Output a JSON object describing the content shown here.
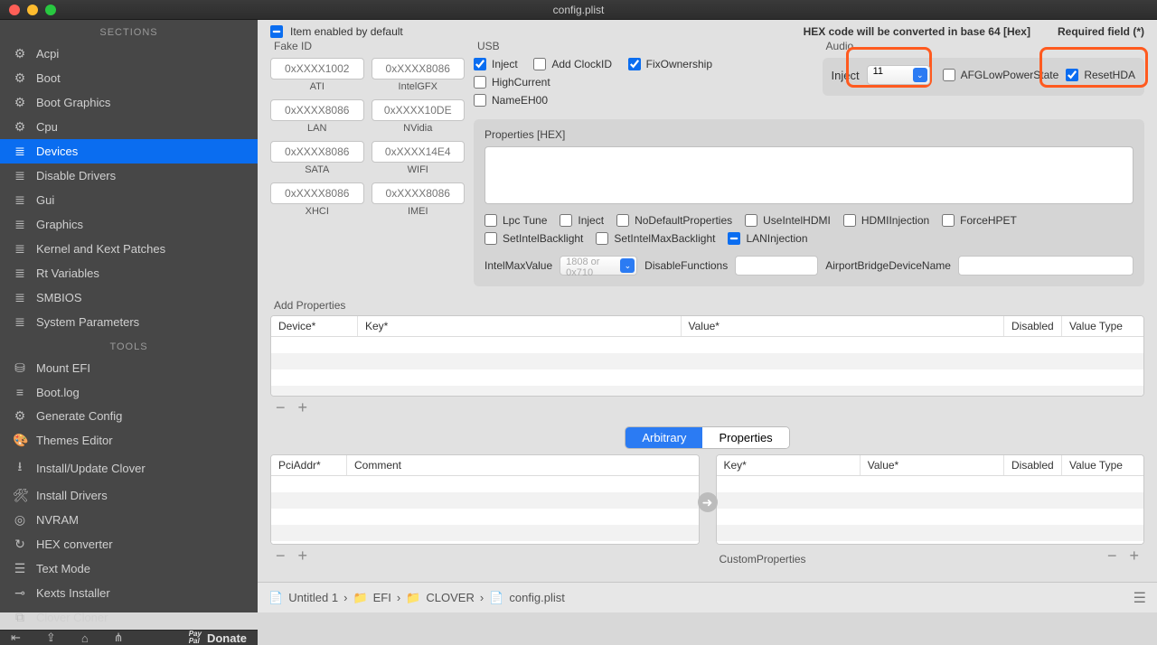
{
  "window": {
    "title": "config.plist"
  },
  "top": {
    "item_enabled": "Item enabled by default",
    "hex_hint": "HEX code will be converted in base 64 [Hex]",
    "required": "Required field (*)"
  },
  "sidebar": {
    "header_sections": "SECTIONS",
    "header_tools": "TOOLS",
    "sections": [
      {
        "label": "Acpi",
        "icon": "gear"
      },
      {
        "label": "Boot",
        "icon": "gear"
      },
      {
        "label": "Boot Graphics",
        "icon": "gear"
      },
      {
        "label": "Cpu",
        "icon": "gear"
      },
      {
        "label": "Devices",
        "icon": "list",
        "active": true
      },
      {
        "label": "Disable Drivers",
        "icon": "list"
      },
      {
        "label": "Gui",
        "icon": "list"
      },
      {
        "label": "Graphics",
        "icon": "list"
      },
      {
        "label": "Kernel and Kext Patches",
        "icon": "list"
      },
      {
        "label": "Rt Variables",
        "icon": "list"
      },
      {
        "label": "SMBIOS",
        "icon": "list"
      },
      {
        "label": "System Parameters",
        "icon": "list"
      }
    ],
    "tools": [
      {
        "label": "Mount EFI",
        "icon": "drive"
      },
      {
        "label": "Boot.log",
        "icon": "bars"
      },
      {
        "label": "Generate Config",
        "icon": "gear"
      },
      {
        "label": "Themes Editor",
        "icon": "palette"
      },
      {
        "label": "Install/Update Clover",
        "icon": "download"
      },
      {
        "label": "Install Drivers",
        "icon": "wrench"
      },
      {
        "label": "NVRAM",
        "icon": "chip"
      },
      {
        "label": "HEX converter",
        "icon": "refresh"
      },
      {
        "label": "Text Mode",
        "icon": "text"
      },
      {
        "label": "Kexts Installer",
        "icon": "key"
      },
      {
        "label": "Clover Cloner",
        "icon": "copy"
      }
    ],
    "footer": {
      "donate": "Donate",
      "paypal": "Pay\nPal"
    }
  },
  "fakeid": {
    "title": "Fake ID",
    "fields": [
      {
        "ph": "0xXXXX1002",
        "label": "ATI"
      },
      {
        "ph": "0xXXXX8086",
        "label": "IntelGFX"
      },
      {
        "ph": "0xXXXX8086",
        "label": "LAN"
      },
      {
        "ph": "0xXXXX10DE",
        "label": "NVidia"
      },
      {
        "ph": "0xXXXX8086",
        "label": "SATA"
      },
      {
        "ph": "0xXXXX14E4",
        "label": "WIFI"
      },
      {
        "ph": "0xXXXX8086",
        "label": "XHCI"
      },
      {
        "ph": "0xXXXX8086",
        "label": "IMEI"
      }
    ]
  },
  "usb": {
    "title": "USB",
    "inject": "Inject",
    "addclock": "Add ClockID",
    "fixown": "FixOwnership",
    "highcurrent": "HighCurrent",
    "nameeh": "NameEH00"
  },
  "audio": {
    "title": "Audio",
    "inject_label": "Inject",
    "inject_value": "11",
    "afg": "AFGLowPowerState",
    "reset": "ResetHDA"
  },
  "props": {
    "title": "Properties [HEX]",
    "flags": [
      "Lpc Tune",
      "Inject",
      "NoDefaultProperties",
      "UseIntelHDMI",
      "HDMIInjection",
      "ForceHPET",
      "SetIntelBacklight",
      "SetIntelMaxBacklight",
      "LANInjection"
    ],
    "intelmax_label": "IntelMaxValue",
    "intelmax_ph": "1808 or 0x710",
    "disablefn_label": "DisableFunctions",
    "airport_label": "AirportBridgeDeviceName"
  },
  "addprops": {
    "title": "Add Properties",
    "cols": {
      "device": "Device*",
      "key": "Key*",
      "value": "Value*",
      "disabled": "Disabled",
      "vtype": "Value Type"
    }
  },
  "tabs": {
    "arbitrary": "Arbitrary",
    "properties": "Properties"
  },
  "left_table": {
    "cols": {
      "pci": "PciAddr*",
      "comment": "Comment"
    }
  },
  "right_table": {
    "cols": {
      "key": "Key*",
      "value": "Value*",
      "disabled": "Disabled",
      "vtype": "Value Type"
    },
    "custom": "CustomProperties"
  },
  "breadcrumb": {
    "untitled": "Untitled 1",
    "efi": "EFI",
    "clover": "CLOVER",
    "file": "config.plist"
  }
}
